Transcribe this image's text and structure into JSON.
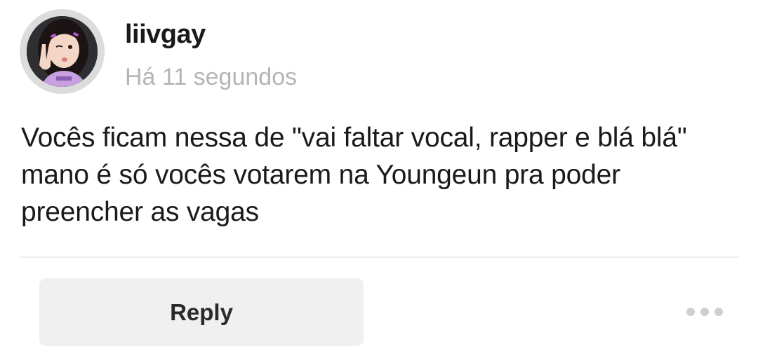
{
  "comment": {
    "author": {
      "username": "liivgay",
      "avatar_icon": "profile-photo"
    },
    "timestamp": "Há 11 segundos",
    "text": "Vocês ficam nessa de \"vai faltar vocal, rapper e blá blá\" mano é só vocês votarem na Youngeun pra poder preencher as vagas"
  },
  "actions": {
    "reply_label": "Reply",
    "more_icon": "more-horizontal-icon"
  },
  "colors": {
    "timestamp": "#b5b5b5",
    "reply_bg": "#f0f0f0",
    "divider": "#ececec",
    "avatar_ring": "#dcdcdc"
  }
}
